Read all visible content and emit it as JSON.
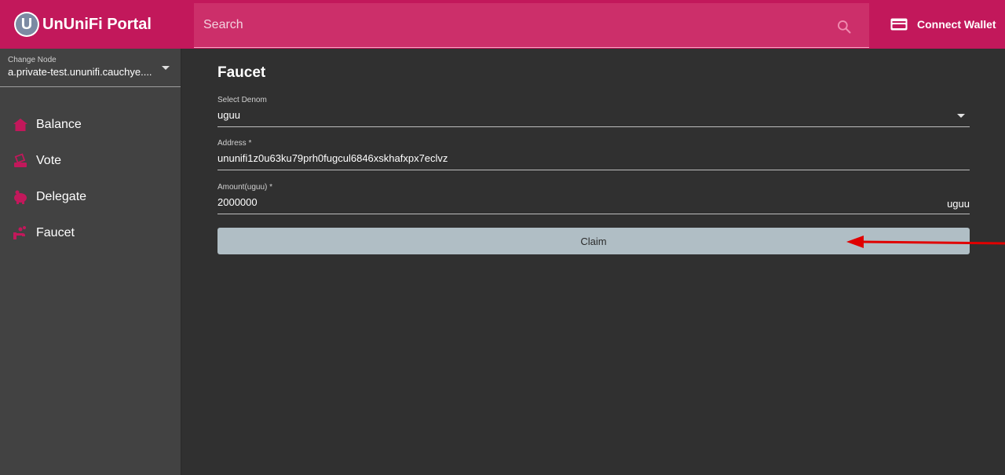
{
  "header": {
    "logo_letter": "U",
    "app_title": "UnUniFi Portal",
    "search_placeholder": "Search",
    "connect_wallet_label": "Connect Wallet",
    "accent_color": "#c2185b"
  },
  "sidebar": {
    "node_label": "Change Node",
    "node_value": "a.private-test.ununifi.cauchye....",
    "items": [
      {
        "label": "Balance",
        "icon": "home-icon"
      },
      {
        "label": "Vote",
        "icon": "vote-icon"
      },
      {
        "label": "Delegate",
        "icon": "piggy-bank-icon"
      },
      {
        "label": "Faucet",
        "icon": "faucet-icon"
      }
    ]
  },
  "main": {
    "title": "Faucet",
    "denom": {
      "label": "Select Denom",
      "value": "uguu"
    },
    "address": {
      "label": "Address *",
      "value": "ununifi1z0u63ku79prh0fugcul6846xskhafxpx7eclvz"
    },
    "amount": {
      "label": "Amount(uguu) *",
      "value": "2000000",
      "suffix": "uguu"
    },
    "claim_label": "Claim"
  },
  "annotation": {
    "arrow_color": "#e00000"
  }
}
